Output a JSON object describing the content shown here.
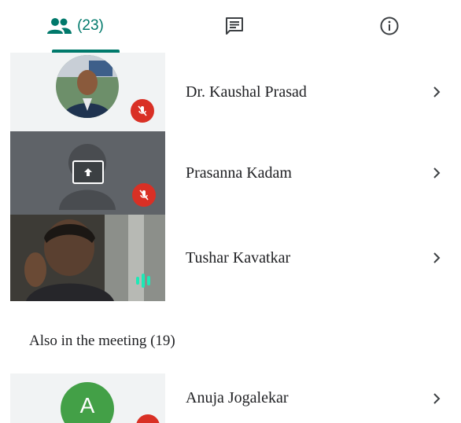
{
  "tabs": {
    "people_count": "(23)",
    "people_icon": "people-icon",
    "chat_icon": "chat-icon",
    "info_icon": "info-icon",
    "active": "people",
    "accent_color": "#00796b"
  },
  "participants": [
    {
      "name": "Dr. Kaushal Prasad",
      "status": "muted"
    },
    {
      "name": "Prasanna Kadam",
      "status": "muted",
      "presenting": true
    },
    {
      "name": "Tushar Kavatkar",
      "status": "speaking"
    }
  ],
  "also_in_meeting": {
    "label": "Also in the meeting (19)",
    "participants": [
      {
        "name": "Anuja Jogalekar",
        "avatar_letter": "A",
        "avatar_color": "#43a047"
      }
    ]
  },
  "colors": {
    "muted_badge": "#d93025",
    "speaking": "#1de9b6"
  }
}
